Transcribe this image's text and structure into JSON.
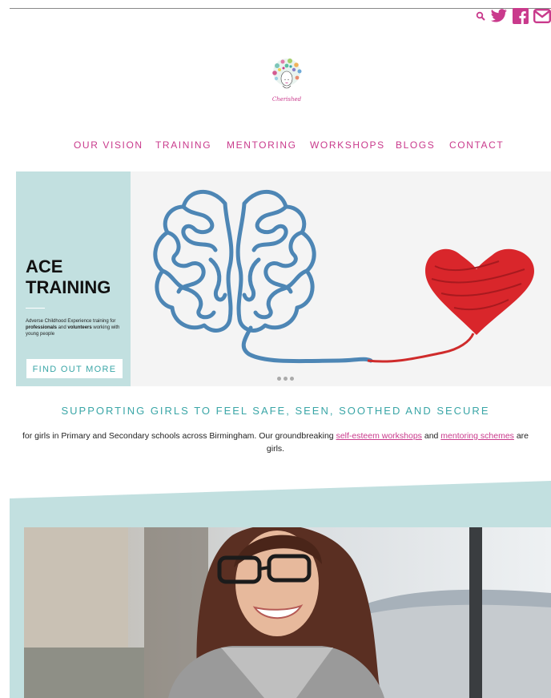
{
  "colors": {
    "accent": "#c93a8c",
    "teal": "#3aa6a7",
    "panel": "#c2e0e0"
  },
  "header": {
    "icons": [
      "search-icon",
      "twitter-icon",
      "facebook-icon",
      "mail-icon"
    ],
    "logo_text": "Cherished"
  },
  "nav": {
    "items": [
      "OUR VISION",
      "TRAINING",
      "MENTORING",
      "WORKSHOPS",
      "BLOGS",
      "CONTACT"
    ]
  },
  "hero": {
    "title_line1": "ACE",
    "title_line2": "TRAINING",
    "desc_1": "Adverse Childhood Experience training for ",
    "desc_2": "professionals",
    "desc_3": " and ",
    "desc_4": "volunteers",
    "desc_5": " working with young people",
    "button": "FIND OUT MORE"
  },
  "tagline": "SUPPORTING GIRLS TO FEEL SAFE, SEEN, SOOTHED AND SECURE",
  "intro": {
    "part1": "for girls in Primary and Secondary schools across Birmingham. Our groundbreaking ",
    "link1": "self-esteem workshops",
    "part2": " and ",
    "link2": "mentoring schemes",
    "part3": " are",
    "line2": "girls."
  }
}
